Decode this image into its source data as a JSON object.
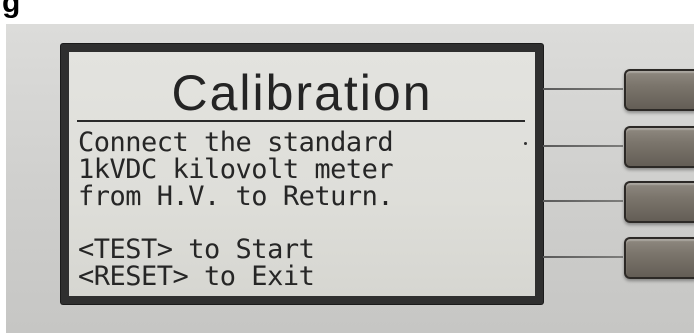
{
  "page_heading": "g",
  "display": {
    "title": "Calibration",
    "lines": [
      "Connect the standard",
      "1kVDC kilovolt meter",
      "from H.V. to Return.",
      "",
      "<TEST> to Start",
      "<RESET> to Exit"
    ]
  },
  "softkeys": [
    "",
    "",
    "",
    ""
  ],
  "colors": {
    "bezel": "#d3d3d1",
    "lcd_background": "#dfdfda",
    "lcd_text": "#262626",
    "softkey": "#7a746b"
  }
}
